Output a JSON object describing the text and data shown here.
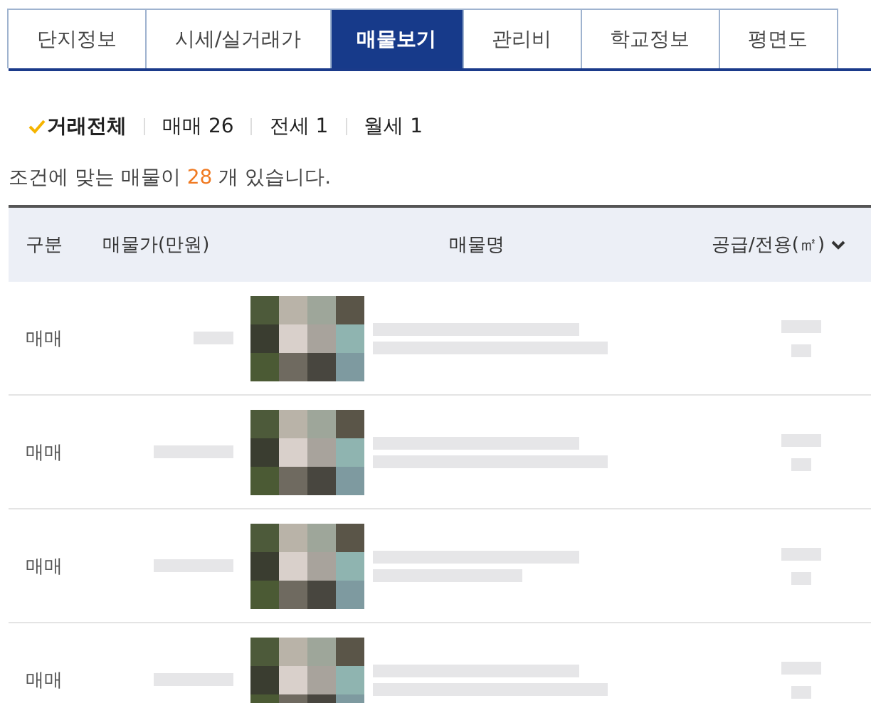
{
  "tabs": [
    {
      "label": "단지정보",
      "selected": false
    },
    {
      "label": "시세/실거래가",
      "selected": false
    },
    {
      "label": "매물보기",
      "selected": true
    },
    {
      "label": "관리비",
      "selected": false
    },
    {
      "label": "학교정보",
      "selected": false
    },
    {
      "label": "평면도",
      "selected": false
    }
  ],
  "filters": [
    {
      "label": "거래전체",
      "selected": true
    },
    {
      "label": "매매 26",
      "selected": false
    },
    {
      "label": "전세 1",
      "selected": false
    },
    {
      "label": "월세 1",
      "selected": false
    }
  ],
  "result": {
    "before": "조건에 맞는 매물이 ",
    "count": "28",
    "after": " 개 있습니다."
  },
  "table": {
    "columns": [
      "구분",
      "매물가(만원)",
      "매물명",
      "공급/전용(㎡)"
    ],
    "rows": [
      {
        "type": "매매"
      },
      {
        "type": "매매"
      },
      {
        "type": "매매"
      },
      {
        "type": "매매"
      }
    ]
  }
}
